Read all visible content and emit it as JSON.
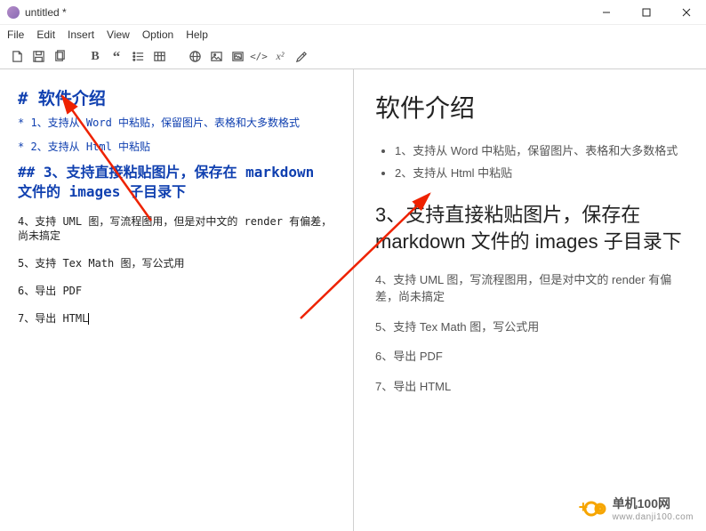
{
  "window": {
    "title": "untitled *"
  },
  "menu": {
    "file": "File",
    "edit": "Edit",
    "insert": "Insert",
    "view": "View",
    "option": "Option",
    "help": "Help"
  },
  "toolbar": {
    "new": "new-file-icon",
    "save": "save-icon",
    "copy": "copy-icon",
    "bold": "B",
    "quote": "quote-icon",
    "list": "list-icon",
    "table": "table-icon",
    "globe": "globe-icon",
    "image": "image-icon",
    "folder": "folder-image-icon",
    "code": "code-icon",
    "superscript": "x²",
    "format": "format-icon"
  },
  "editor": {
    "h1_line": "#  软件介绍",
    "li1": "* 1、支持从 Word 中粘贴，保留图片、表格和大多数格式",
    "li2": "* 2、支持从 Html 中粘贴",
    "h2_line": "## 3、支持直接粘贴图片，保存在 markdown 文件的 images 子目录下",
    "p4": "4、支持 UML 图，写流程图用，但是对中文的 render 有偏差，尚未搞定",
    "p5": "5、支持 Tex Math 图，写公式用",
    "p6": "6、导出 PDF",
    "p7": "7、导出 HTML"
  },
  "preview": {
    "h1": "软件介绍",
    "li1": "1、支持从 Word 中粘贴，保留图片、表格和大多数格式",
    "li2": "2、支持从 Html 中粘贴",
    "h2": "3、支持直接粘贴图片，保存在 markdown 文件的 images 子目录下",
    "p4": "4、支持 UML 图，写流程图用，但是对中文的 render 有偏差，尚未搞定",
    "p5": "5、支持 Tex Math 图，写公式用",
    "p6": "6、导出 PDF",
    "p7": "7、导出 HTML"
  },
  "branding": {
    "name": "单机100网",
    "domain": "www.danji100.com"
  }
}
